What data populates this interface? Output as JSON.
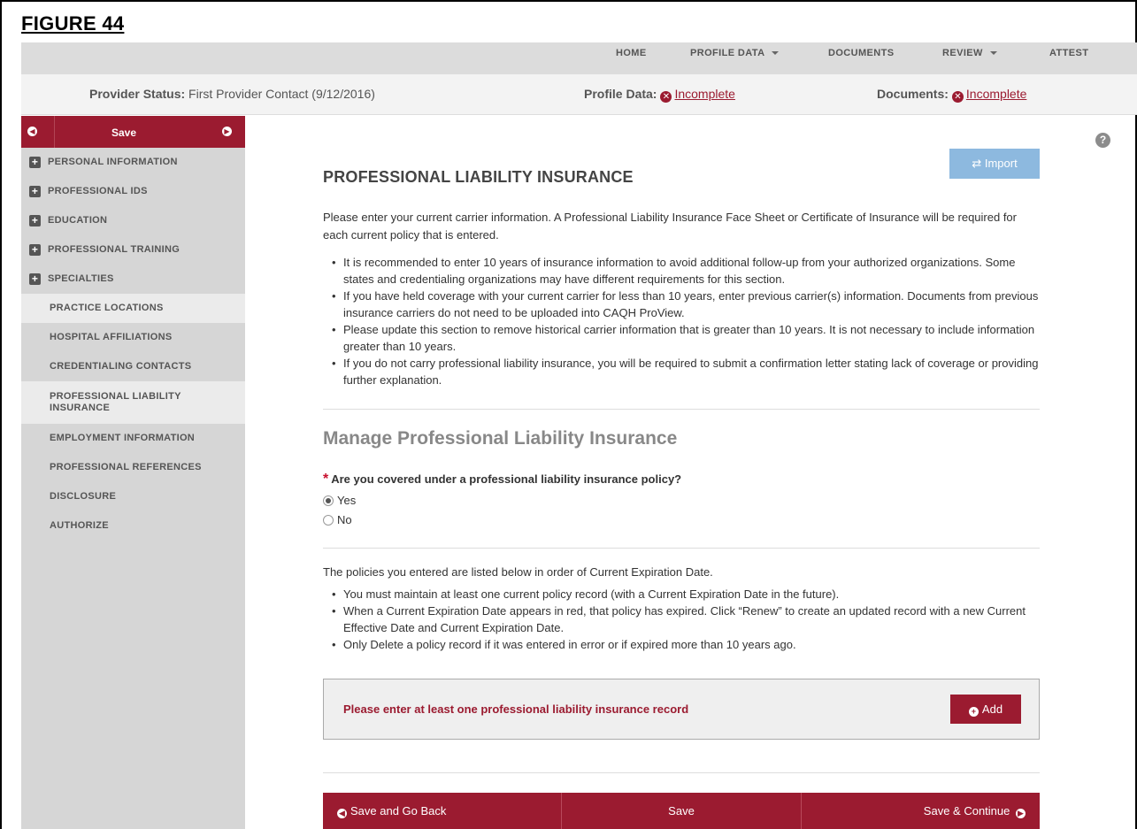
{
  "figure_label": "FIGURE 44",
  "topnav": {
    "home": "HOME",
    "profile_data": "PROFILE DATA",
    "documents": "DOCUMENTS",
    "review": "REVIEW",
    "attest": "ATTEST"
  },
  "status": {
    "provider_label": "Provider Status:",
    "provider_value": "First Provider Contact (9/12/2016)",
    "profile_label": "Profile Data:",
    "profile_value": "Incomplete",
    "documents_label": "Documents:",
    "documents_value": "Incomplete"
  },
  "sidebar": {
    "save_label": "Save",
    "items": [
      {
        "label": "PERSONAL INFORMATION"
      },
      {
        "label": "PROFESSIONAL IDS"
      },
      {
        "label": "EDUCATION"
      },
      {
        "label": "PROFESSIONAL TRAINING"
      },
      {
        "label": "SPECIALTIES"
      },
      {
        "label": "PRACTICE LOCATIONS"
      },
      {
        "label": "HOSPITAL AFFILIATIONS"
      },
      {
        "label": "CREDENTIALING CONTACTS"
      },
      {
        "label": "PROFESSIONAL LIABILITY INSURANCE"
      },
      {
        "label": "EMPLOYMENT INFORMATION"
      },
      {
        "label": "PROFESSIONAL REFERENCES"
      },
      {
        "label": "DISCLOSURE"
      },
      {
        "label": "AUTHORIZE"
      }
    ]
  },
  "main": {
    "title": "PROFESSIONAL LIABILITY INSURANCE",
    "import_label": "Import",
    "intro": "Please enter your current carrier information. A Professional Liability Insurance Face Sheet or Certificate of Insurance will be required for each current policy that is entered.",
    "bullets": [
      "It is recommended to enter 10 years of insurance information to avoid additional follow-up from your authorized organizations. Some states and credentialing organizations may have different requirements for this section.",
      "If you have held coverage with your current carrier for less than 10 years, enter previous carrier(s) information. Documents from previous insurance carriers do not need to be uploaded into CAQH ProView.",
      "Please update this section to remove historical carrier information that is greater than 10 years. It is not necessary to include information greater than 10 years.",
      "If you do not carry professional liability insurance, you will be required to submit a confirmation letter stating lack of coverage or providing further explanation."
    ],
    "manage_title": "Manage Professional Liability Insurance",
    "question": "Are you covered under a professional liability insurance policy?",
    "required_mark": "*",
    "option_yes": "Yes",
    "option_no": "No",
    "selected": "Yes",
    "policies_intro": "The policies you entered are listed below in order of Current Expiration Date.",
    "policy_bullets": [
      "You must maintain at least one current policy record (with a Current Expiration Date in the future).",
      "When a Current Expiration Date appears in red, that policy has expired. Click “Renew” to create an updated record with a new Current Effective Date and Current Expiration Date.",
      "Only Delete a policy record if it was entered in error or if expired more than 10 years ago."
    ],
    "warning": "Please enter at least one professional liability insurance record",
    "add_label": "Add"
  },
  "footer": {
    "back_label": "Save and Go Back",
    "save_label": "Save",
    "continue_label": "Save & Continue"
  },
  "colors": {
    "brand": "#9b1b30",
    "import_button": "#8db9df",
    "sidebar_bg": "#d6d6d6"
  }
}
